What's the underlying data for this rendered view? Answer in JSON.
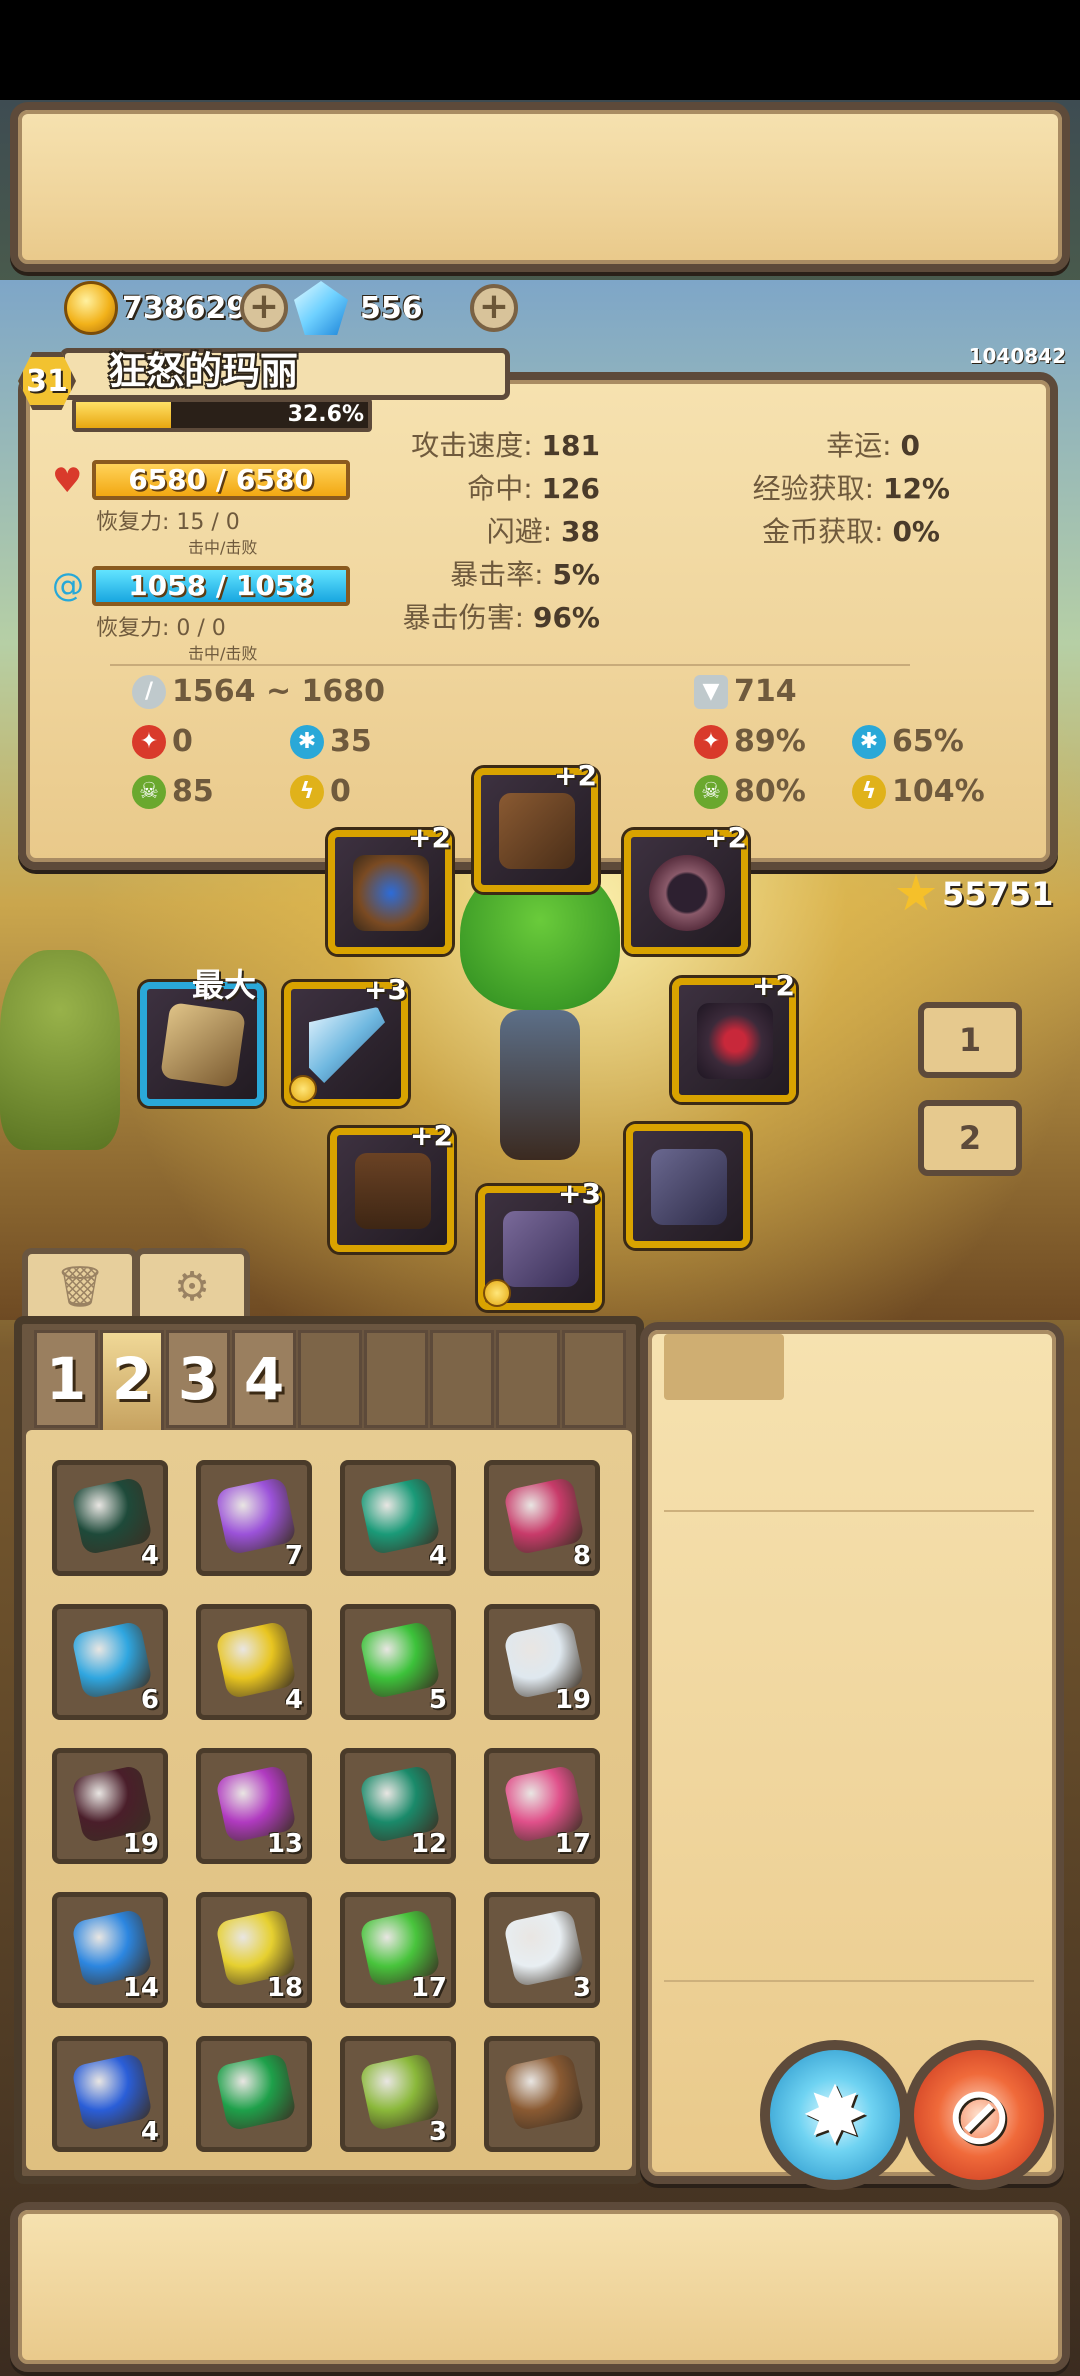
{
  "currency": {
    "gold": "738629",
    "gems": "556",
    "gold_icon": "gold-coin-icon",
    "gem_icon": "diamond-icon"
  },
  "player_id": "1040842",
  "character": {
    "level": "31",
    "name": "狂怒的玛丽",
    "xp_percent_label": "32.6%",
    "xp_fraction": 0.326,
    "hp": "6580 / 6580",
    "hp_regen_label": "恢复力: 15 / 0",
    "hp_regen_sub": "击中/击败",
    "mp": "1058 / 1058",
    "mp_regen_label": "恢复力: 0 / 0",
    "mp_regen_sub": "击中/击败"
  },
  "stats_middle": [
    {
      "label": "攻击速度:",
      "value": "181"
    },
    {
      "label": "命中:",
      "value": "126"
    },
    {
      "label": "闪避:",
      "value": "38"
    },
    {
      "label": "暴击率:",
      "value": "5%"
    },
    {
      "label": "暴击伤害:",
      "value": "96%"
    }
  ],
  "stats_right": [
    {
      "label": "幸运:",
      "value": "0"
    },
    {
      "label": "经验获取:",
      "value": "12%"
    },
    {
      "label": "金币获取:",
      "value": "0%"
    }
  ],
  "damage": {
    "range": "1564 ~ 1680",
    "armor": "714"
  },
  "elements_attack": [
    {
      "icon": "fire-icon",
      "value": "0",
      "color": "#d93a2b"
    },
    {
      "icon": "ice-icon",
      "value": "35",
      "color": "#2aa8d8"
    },
    {
      "icon": "poison-icon",
      "value": "85",
      "color": "#6aa82e"
    },
    {
      "icon": "lightning-icon",
      "value": "0",
      "color": "#e0b21a"
    }
  ],
  "elements_defense": [
    {
      "icon": "fire-resist-icon",
      "value": "89%",
      "color": "#d93a2b"
    },
    {
      "icon": "ice-resist-icon",
      "value": "65%",
      "color": "#2aa8d8"
    },
    {
      "icon": "poison-resist-icon",
      "value": "80%",
      "color": "#6aa82e"
    },
    {
      "icon": "lightning-resist-icon",
      "value": "104%",
      "color": "#e0b21a"
    }
  ],
  "equipment": {
    "hat": {
      "upgrade": "+2",
      "icon": "hat-icon"
    },
    "amulet": {
      "upgrade": "+2",
      "icon": "amulet-icon"
    },
    "ring": {
      "upgrade": "+2",
      "icon": "ring-icon"
    },
    "weapon": {
      "upgrade": "+3",
      "icon": "sword-icon"
    },
    "armor": {
      "upgrade": "+2",
      "icon": "chest-armor-icon"
    },
    "pants": {
      "upgrade": "+2",
      "icon": "pants-icon"
    },
    "gloves": {
      "upgrade": "",
      "icon": "glove-icon"
    },
    "boots": {
      "upgrade": "+3",
      "icon": "boots-icon"
    },
    "offhand": {
      "label": "最大",
      "icon": "scroll-icon"
    }
  },
  "stars": "55751",
  "loadouts": [
    "1",
    "2"
  ],
  "inventory_tabs": [
    "1",
    "2",
    "3",
    "4"
  ],
  "inventory": [
    {
      "qty": "4",
      "color": "#1e4a3a"
    },
    {
      "qty": "7",
      "color": "#9b52d9"
    },
    {
      "qty": "4",
      "color": "#1a9a78"
    },
    {
      "qty": "8",
      "color": "#c83b6a"
    },
    {
      "qty": "6",
      "color": "#2fa6e0"
    },
    {
      "qty": "4",
      "color": "#e8c520"
    },
    {
      "qty": "5",
      "color": "#3cc23a"
    },
    {
      "qty": "19",
      "color": "#dfe8ef"
    },
    {
      "qty": "19",
      "color": "#4a1e2a"
    },
    {
      "qty": "13",
      "color": "#b03ac0"
    },
    {
      "qty": "12",
      "color": "#1a8a6a"
    },
    {
      "qty": "17",
      "color": "#e0508a"
    },
    {
      "qty": "14",
      "color": "#2c86e0"
    },
    {
      "qty": "18",
      "color": "#e6d030"
    },
    {
      "qty": "17",
      "color": "#48c43c"
    },
    {
      "qty": "3",
      "color": "#e8eef2"
    },
    {
      "qty": "4",
      "color": "#2a5ed8"
    },
    {
      "qty": "",
      "color": "#1ea04a"
    },
    {
      "qty": "3",
      "color": "#8ab83a"
    },
    {
      "qty": "",
      "color": "#8a5a32"
    }
  ]
}
